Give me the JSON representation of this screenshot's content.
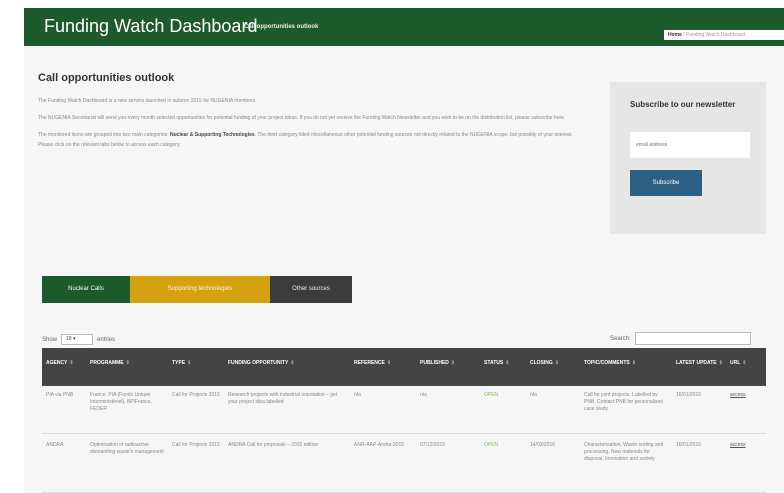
{
  "header": {
    "title": "Funding Watch Dashboard",
    "subtitle": "Call opportunities outlook",
    "breadcrumb_home": "Home",
    "breadcrumb_current": "/ Funding Watch Dashboard"
  },
  "main": {
    "heading": "Call opportunities outlook",
    "para1": "The Funding Watch Dashboard is a new service launched in autumn 2015 for NUGENIA members.",
    "para2": "The NUGENIA Secretariat will send you every month selected opportunities for potential funding of your project ideas. If you do not yet receive the Funding Watch Newsletter and you wish to be on the distribution list, please subscribe here.",
    "para3_start": "The monitored items are grouped into two main categories: ",
    "para3_bold": "Nuclear & Supporting Technologies",
    "para3_end": ". The third category titled miscellaneous other potential funding sources not directly related to the NUGENIA scope, but possibly of your interest. Please click on the relevant tabs below to access each category."
  },
  "newsletter": {
    "title": "Subscribe to our newsletter",
    "email_placeholder": "email address",
    "button_label": "Subscribe"
  },
  "tabs": [
    {
      "label": "Nuclear Calls"
    },
    {
      "label": "Supporting technologies"
    },
    {
      "label": "Other sources"
    }
  ],
  "table_controls": {
    "show_label": "Show",
    "page_size": "10",
    "entries_label": "entries",
    "search_label": "Search:"
  },
  "table": {
    "columns": [
      "AGENCY",
      "PROGRAMME",
      "TYPE",
      "FUNDING OPPORTUNITY",
      "REFERENCE",
      "PUBLISHED",
      "STATUS",
      "CLOSING",
      "TOPIC/COMMENTS",
      "LATEST UPDATE",
      "URL"
    ],
    "rows": [
      {
        "agency": "PIA via PNB",
        "programme": "France, PIA (Fonds Unique Interministériel), BPIFrance, FEDER",
        "type": "Call for Projects 2015",
        "opportunity": "Research projects with industrial orientation – get your project idea labelled",
        "reference": "n/a",
        "published": "n/a",
        "status": "OPEN",
        "closing": "n/a",
        "topic": "Call for joint projects. Labelled by PNB. Contact PNB for personalised case study",
        "latest_update": "16/01/2016",
        "url": "access"
      },
      {
        "agency": "ANDRA",
        "programme": "Optimisation of radioactive dismantling waste's management",
        "type": "Call for Projects 2015",
        "opportunity": "ANDRA Call for proposals – 2015 edition",
        "reference": "ANR-AAP-Andra-2015",
        "published": "07/12/2015",
        "status": "OPEN",
        "closing": "14/03/2016",
        "topic": "Characterisation, Waste sorting and processing, New materials for disposal, Innovation and society",
        "latest_update": "16/01/2016",
        "url": "access"
      }
    ]
  },
  "colors": {
    "brand_green": "#1e5b2c",
    "tab_yellow": "#d4a20f",
    "tab_gray": "#3c3c3c",
    "button_blue": "#2e5f85",
    "status_green": "#7cbd4d"
  }
}
